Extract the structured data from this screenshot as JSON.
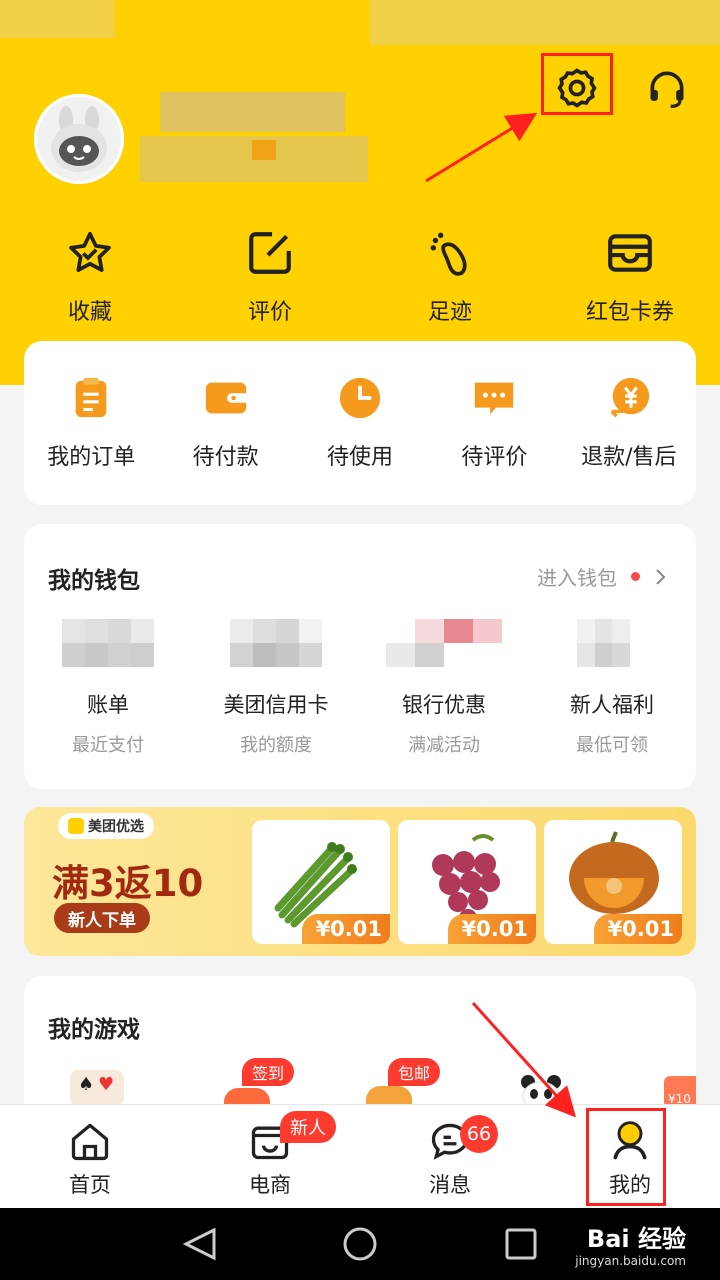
{
  "quick_links": [
    {
      "label": "收藏",
      "icon": "star-icon"
    },
    {
      "label": "评价",
      "icon": "edit-icon"
    },
    {
      "label": "足迹",
      "icon": "footprint-icon"
    },
    {
      "label": "红包卡券",
      "icon": "wallet-card-icon"
    }
  ],
  "orders": [
    {
      "label": "我的订单",
      "icon": "order-list-icon"
    },
    {
      "label": "待付款",
      "icon": "payment-wallet-icon"
    },
    {
      "label": "待使用",
      "icon": "clock-icon"
    },
    {
      "label": "待评价",
      "icon": "chat-bubble-icon"
    },
    {
      "label": "退款/售后",
      "icon": "refund-yen-icon"
    }
  ],
  "wallet": {
    "title": "我的钱包",
    "enter_label": "进入钱包",
    "items": [
      {
        "name": "账单",
        "sub": "最近支付"
      },
      {
        "name": "美团信用卡",
        "sub": "我的额度"
      },
      {
        "name": "银行优惠",
        "sub": "满减活动"
      },
      {
        "name": "新人福利",
        "sub": "最低可领"
      }
    ]
  },
  "banner": {
    "brand": "美团优选",
    "headline": "满3返10",
    "cta": "新人下单",
    "products": [
      {
        "name": "asparagus",
        "price": "¥0.01"
      },
      {
        "name": "grapes",
        "price": "¥0.01"
      },
      {
        "name": "pumpkin",
        "price": "¥0.01"
      }
    ]
  },
  "games": {
    "title": "我的游戏",
    "tags": [
      "签到",
      "包邮"
    ],
    "corner_label": "¥10"
  },
  "tabbar": {
    "tabs": [
      {
        "label": "首页",
        "icon": "home-icon"
      },
      {
        "label": "电商",
        "icon": "shop-icon",
        "badge": "新人"
      },
      {
        "label": "消息",
        "icon": "message-icon",
        "badge": "66"
      },
      {
        "label": "我的",
        "icon": "profile-icon"
      }
    ]
  },
  "watermark": {
    "brand": "Bai 经验",
    "url": "jingyan.baidu.com"
  },
  "colors": {
    "brand_yellow": "#ffd100",
    "highlight_red": "#ff2020",
    "accent_orange": "#f59a1d"
  }
}
